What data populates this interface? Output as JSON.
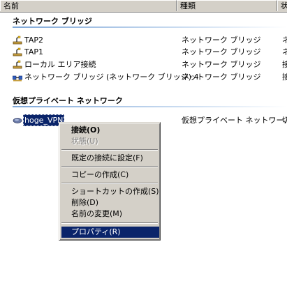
{
  "columns": [
    {
      "label": "名前"
    },
    {
      "label": "種類"
    },
    {
      "label": "状"
    }
  ],
  "groups": [
    {
      "title": "ネットワーク ブリッジ",
      "items": [
        {
          "name": "TAP2",
          "type": "ネットワーク ブリッジ",
          "extra": "ネ",
          "icon": "network-connection-icon"
        },
        {
          "name": "TAP1",
          "type": "ネットワーク ブリッジ",
          "extra": "ネ",
          "icon": "network-connection-icon"
        },
        {
          "name": "ローカル エリア接続",
          "type": "ネットワーク ブリッジ",
          "extra": "接",
          "icon": "network-connection-icon"
        },
        {
          "name": "ネットワーク ブリッジ (ネットワーク ブリッジ) 4",
          "type": "ネットワーク ブリッジ",
          "extra": "接",
          "icon": "network-bridge-icon"
        }
      ]
    },
    {
      "title": "仮想プライベート ネットワーク",
      "items": [
        {
          "name": "hoge_VPN",
          "type": "仮想プライベート ネットワー...",
          "extra": "切",
          "icon": "vpn-connection-icon",
          "selected": true
        }
      ]
    }
  ],
  "context_menu": {
    "items": [
      {
        "label": "接続(O)",
        "bold": true
      },
      {
        "label": "状態(U)",
        "disabled": true
      },
      {
        "label": "既定の接続に設定(F)"
      },
      {
        "label": "コピーの作成(C)"
      },
      {
        "label": "ショートカットの作成(S)"
      },
      {
        "label": "削除(D)"
      },
      {
        "label": "名前の変更(M)"
      },
      {
        "label": "プロパティ(R)",
        "highlighted": true
      }
    ]
  },
  "colors": {
    "selection": "#0a246a",
    "menu_face": "#d4d0c8",
    "group_line": "#7ea7d8"
  }
}
